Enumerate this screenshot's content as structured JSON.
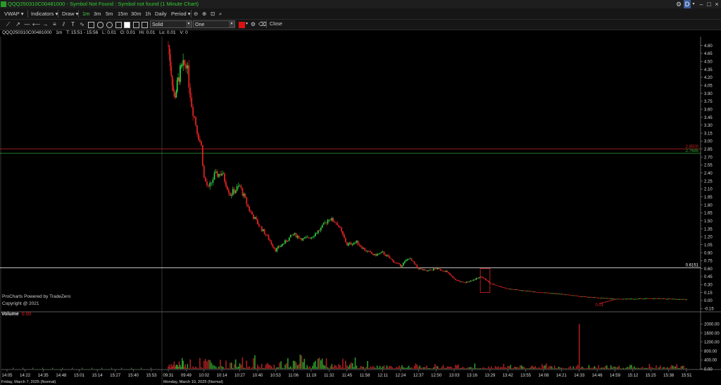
{
  "window": {
    "title": "QQQ250310C00481000 - Symbol Not Found : Symbol not found (1 Minute Chart)",
    "link_label": "D"
  },
  "menu": {
    "vwap": "VWAP",
    "indicators": "Indicators",
    "draw": "Draw",
    "timeframes": [
      "1m",
      "3m",
      "5m",
      "15m",
      "30m",
      "1h",
      "Daily"
    ],
    "active_timeframe": "1m",
    "period": "Period"
  },
  "toolbar": {
    "line_style": "Solid",
    "line_mode": "One",
    "close_label": "Close",
    "accent_color": "#dd1111"
  },
  "info": {
    "symbol": "QQQ250310C00481000",
    "interval": "1m",
    "time": "T: 15:51 - 15:56",
    "low": "L: 0.01",
    "open": "O: 0.01",
    "high": "Hi: 0.01",
    "last": "Lo: 0.01",
    "volume": "V: 0"
  },
  "volume_label": "Volume",
  "volume_value": "0.00",
  "credits": {
    "line1": "ProCharts Powered by TradeZero",
    "line2": "Copyright @ 2021"
  },
  "chart_data": {
    "type": "candlestick",
    "price_axis": [
      "4.80",
      "4.65",
      "4.50",
      "4.35",
      "4.20",
      "4.05",
      "3.90",
      "3.75",
      "3.60",
      "3.45",
      "3.30",
      "3.15",
      "3.00",
      "2.85",
      "2.70",
      "2.55",
      "2.40",
      "2.25",
      "2.10",
      "1.95",
      "1.80",
      "1.65",
      "1.50",
      "1.35",
      "1.20",
      "1.05",
      "0.90",
      "0.75",
      "0.60",
      "0.45",
      "0.30",
      "0.15",
      "0.00",
      "-0.15"
    ],
    "ylim": [
      -0.2,
      4.9
    ],
    "volume_axis": [
      "2000.00",
      "1600.00",
      "1200.00",
      "800.00",
      "400.00",
      "0.00"
    ],
    "volume_ylim": [
      0,
      2200
    ],
    "time_labels": [
      "14:05",
      "14:22",
      "14:35",
      "14:48",
      "15:01",
      "15:14",
      "15:27",
      "15:40",
      "15:53",
      "09:31",
      "09:49",
      "10:02",
      "10:14",
      "10:27",
      "10:40",
      "10:53",
      "11:06",
      "11:19",
      "11:32",
      "11:45",
      "11:58",
      "12:11",
      "12:24",
      "12:37",
      "12:50",
      "13:03",
      "13:16",
      "13:29",
      "13:42",
      "13:55",
      "14:08",
      "14:21",
      "14:33",
      "14:46",
      "14:59",
      "15:12",
      "15:25",
      "15:38",
      "15:51"
    ],
    "date_labels": [
      "Friday, March 7, 2025 (Normal)",
      "Monday, March 10, 2025 (Normal)"
    ],
    "price_lines": [
      {
        "label": "2.8500",
        "value": 2.85,
        "color": "#cc2222"
      },
      {
        "label": "2.7685",
        "value": 2.7685,
        "color": "#33aa33"
      },
      {
        "label": "0.6151",
        "value": 0.6151,
        "color": "#ffffff"
      }
    ],
    "annotation_low": "0.01",
    "path_points": [
      {
        "t": "09:31",
        "price": 4.8
      },
      {
        "t": "09:37",
        "price": 3.8
      },
      {
        "t": "09:43",
        "price": 4.3
      },
      {
        "t": "09:49",
        "price": 4.5
      },
      {
        "t": "09:53",
        "price": 3.7
      },
      {
        "t": "09:57",
        "price": 3.2
      },
      {
        "t": "10:00",
        "price": 2.9
      },
      {
        "t": "10:02",
        "price": 2.3
      },
      {
        "t": "10:05",
        "price": 2.1
      },
      {
        "t": "10:09",
        "price": 2.35
      },
      {
        "t": "10:14",
        "price": 2.4
      },
      {
        "t": "10:20",
        "price": 2.0
      },
      {
        "t": "10:27",
        "price": 2.15
      },
      {
        "t": "10:34",
        "price": 1.7
      },
      {
        "t": "10:40",
        "price": 1.45
      },
      {
        "t": "10:47",
        "price": 1.2
      },
      {
        "t": "10:53",
        "price": 0.95
      },
      {
        "t": "11:00",
        "price": 1.1
      },
      {
        "t": "11:06",
        "price": 1.25
      },
      {
        "t": "11:13",
        "price": 1.15
      },
      {
        "t": "11:19",
        "price": 1.2
      },
      {
        "t": "11:26",
        "price": 1.35
      },
      {
        "t": "11:32",
        "price": 1.55
      },
      {
        "t": "11:38",
        "price": 1.45
      },
      {
        "t": "11:45",
        "price": 1.05
      },
      {
        "t": "11:52",
        "price": 1.1
      },
      {
        "t": "11:58",
        "price": 0.95
      },
      {
        "t": "12:05",
        "price": 0.85
      },
      {
        "t": "12:11",
        "price": 0.9
      },
      {
        "t": "12:18",
        "price": 0.75
      },
      {
        "t": "12:24",
        "price": 0.65
      },
      {
        "t": "12:30",
        "price": 0.8
      },
      {
        "t": "12:37",
        "price": 0.6
      },
      {
        "t": "12:43",
        "price": 0.55
      },
      {
        "t": "12:50",
        "price": 0.6
      },
      {
        "t": "12:57",
        "price": 0.55
      },
      {
        "t": "13:03",
        "price": 0.4
      },
      {
        "t": "13:10",
        "price": 0.33
      },
      {
        "t": "13:16",
        "price": 0.38
      },
      {
        "t": "13:23",
        "price": 0.45
      },
      {
        "t": "13:29",
        "price": 0.32
      },
      {
        "t": "13:42",
        "price": 0.22
      },
      {
        "t": "13:55",
        "price": 0.18
      },
      {
        "t": "14:08",
        "price": 0.15
      },
      {
        "t": "14:21",
        "price": 0.12
      },
      {
        "t": "14:33",
        "price": 0.08
      },
      {
        "t": "14:46",
        "price": 0.05
      },
      {
        "t": "14:59",
        "price": 0.03
      },
      {
        "t": "15:12",
        "price": 0.03
      },
      {
        "t": "15:25",
        "price": 0.04
      },
      {
        "t": "15:38",
        "price": 0.03
      },
      {
        "t": "15:51",
        "price": 0.02
      }
    ]
  }
}
